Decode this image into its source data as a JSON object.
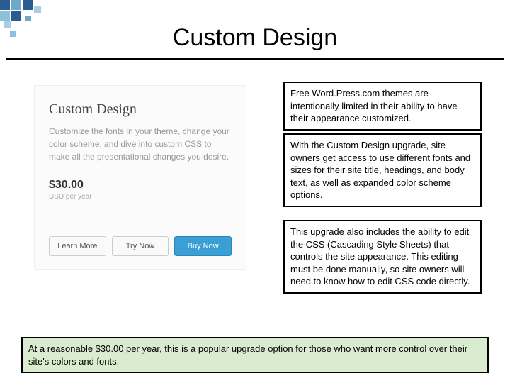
{
  "title": "Custom Design",
  "card": {
    "heading": "Custom Design",
    "description": "Customize the fonts in your theme, change your color scheme, and dive into custom CSS to make all the presentational changes you desire.",
    "price": "$30.00",
    "price_note": "USD per year",
    "buttons": {
      "learn": "Learn More",
      "try": "Try Now",
      "buy": "Buy Now"
    }
  },
  "boxes": {
    "b1": "Free Word.Press.com themes are intentionally limited in their ability to have their appearance customized.",
    "b2": "With the Custom Design upgrade, site owners get access to use different fonts and sizes for their site title, headings, and body text, as well as expanded color scheme options.",
    "b3": "This upgrade also includes the ability to edit the CSS (Cascading Style Sheets) that controls the site appearance.  This editing must be done manually, so site owners will need to know how to edit CSS code directly."
  },
  "footer": "At a reasonable $30.00 per year, this is a popular upgrade option for those who want more control over their site's colors and fonts."
}
